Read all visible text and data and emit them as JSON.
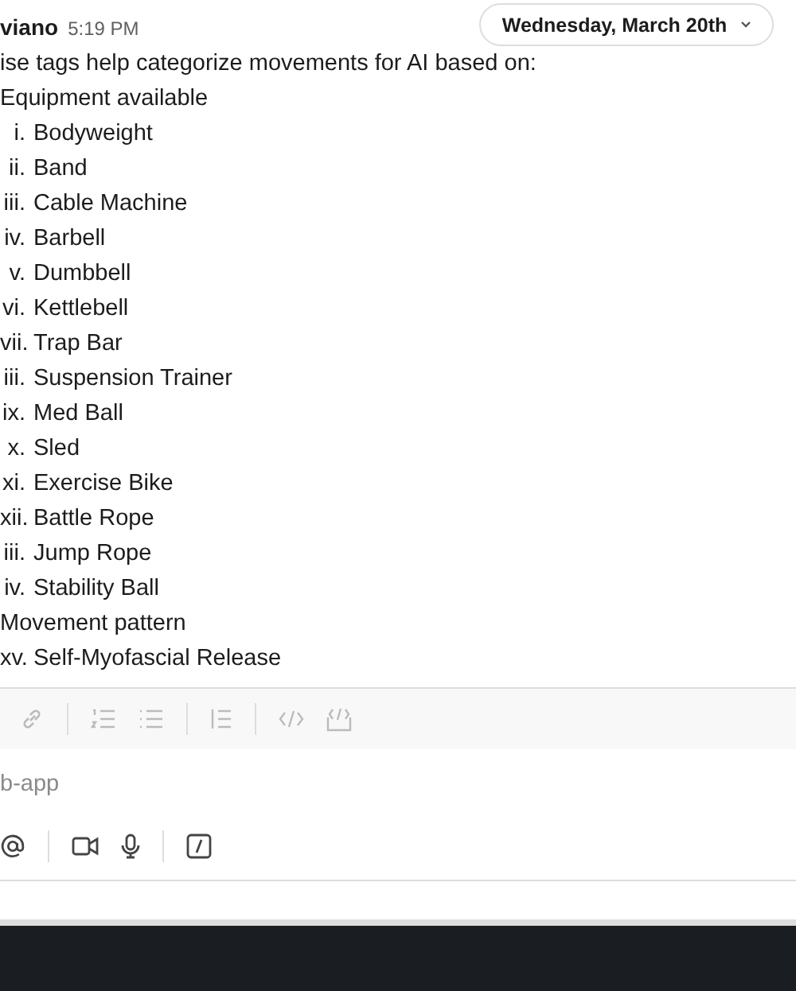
{
  "message": {
    "author": "viano",
    "time": "5:19 PM",
    "intro": "ise tags help categorize movements for AI based on:",
    "sections": [
      {
        "label": "Equipment available",
        "items": [
          {
            "num": "i.",
            "text": "Bodyweight"
          },
          {
            "num": "ii.",
            "text": "Band"
          },
          {
            "num": "iii.",
            "text": "Cable Machine"
          },
          {
            "num": "iv.",
            "text": "Barbell"
          },
          {
            "num": "v.",
            "text": "Dumbbell"
          },
          {
            "num": "vi.",
            "text": "Kettlebell"
          },
          {
            "num": "vii.",
            "text": "Trap Bar"
          },
          {
            "num": "iii.",
            "text": "Suspension Trainer"
          },
          {
            "num": "ix.",
            "text": "Med Ball"
          },
          {
            "num": "x.",
            "text": "Sled"
          },
          {
            "num": "xi.",
            "text": "Exercise Bike"
          },
          {
            "num": "xii.",
            "text": "Battle Rope"
          },
          {
            "num": "iii.",
            "text": "Jump Rope"
          },
          {
            "num": "iv.",
            "text": "Stability Ball"
          }
        ]
      },
      {
        "label": "Movement pattern",
        "items": [
          {
            "num": "xv.",
            "text": "Self-Myofascial Release"
          }
        ]
      }
    ]
  },
  "date_pill": {
    "label": "Wednesday, March 20th"
  },
  "composer": {
    "placeholder": "b-app"
  }
}
